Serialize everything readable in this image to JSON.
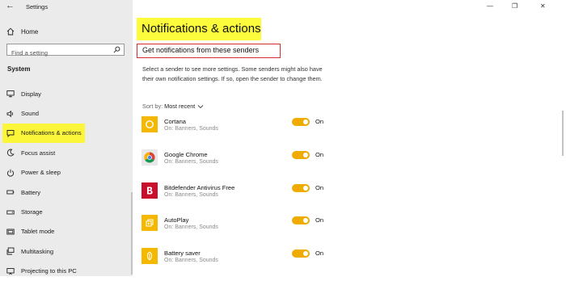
{
  "window": {
    "title": "Settings",
    "back_glyph": "←",
    "controls": {
      "minimize": "—",
      "maximize": "❐",
      "close": "✕"
    }
  },
  "sidebar": {
    "home_label": "Home",
    "search_placeholder": "Find a setting",
    "section": "System",
    "items": [
      {
        "label": "Display",
        "icon": "monitor-icon"
      },
      {
        "label": "Sound",
        "icon": "speaker-icon"
      },
      {
        "label": "Notifications & actions",
        "icon": "notification-icon",
        "active": true
      },
      {
        "label": "Focus assist",
        "icon": "moon-icon"
      },
      {
        "label": "Power & sleep",
        "icon": "power-icon"
      },
      {
        "label": "Battery",
        "icon": "battery-icon"
      },
      {
        "label": "Storage",
        "icon": "storage-icon"
      },
      {
        "label": "Tablet mode",
        "icon": "tablet-icon"
      },
      {
        "label": "Multitasking",
        "icon": "multitasking-icon"
      },
      {
        "label": "Projecting to this PC",
        "icon": "projector-icon"
      }
    ]
  },
  "main": {
    "page_title": "Notifications & actions",
    "section_title": "Get notifications from these senders",
    "description": "Select a sender to see more settings. Some senders might also have their own notification settings. If so, open the sender to change them.",
    "sort_label": "Sort by:",
    "sort_value": "Most recent",
    "senders": [
      {
        "name": "Cortana",
        "sub": "On: Banners, Sounds",
        "toggle": "On",
        "icon": "cortana-icon"
      },
      {
        "name": "Google Chrome",
        "sub": "On: Banners, Sounds",
        "toggle": "On",
        "icon": "chrome-icon"
      },
      {
        "name": "Bitdefender Antivirus Free",
        "sub": "On: Banners, Sounds",
        "toggle": "On",
        "icon": "bitdefender-icon"
      },
      {
        "name": "AutoPlay",
        "sub": "On: Banners, Sounds",
        "toggle": "On",
        "icon": "autoplay-icon"
      },
      {
        "name": "Battery saver",
        "sub": "On: Banners, Sounds",
        "toggle": "On",
        "icon": "battery-saver-icon"
      }
    ]
  },
  "colors": {
    "highlight": "#fcfb3c",
    "accent_toggle": "#f0ab00",
    "sender_icon_bg": "#f5b800",
    "annotation_box": "#d52d2d",
    "bitdefender_red": "#c8102e"
  }
}
